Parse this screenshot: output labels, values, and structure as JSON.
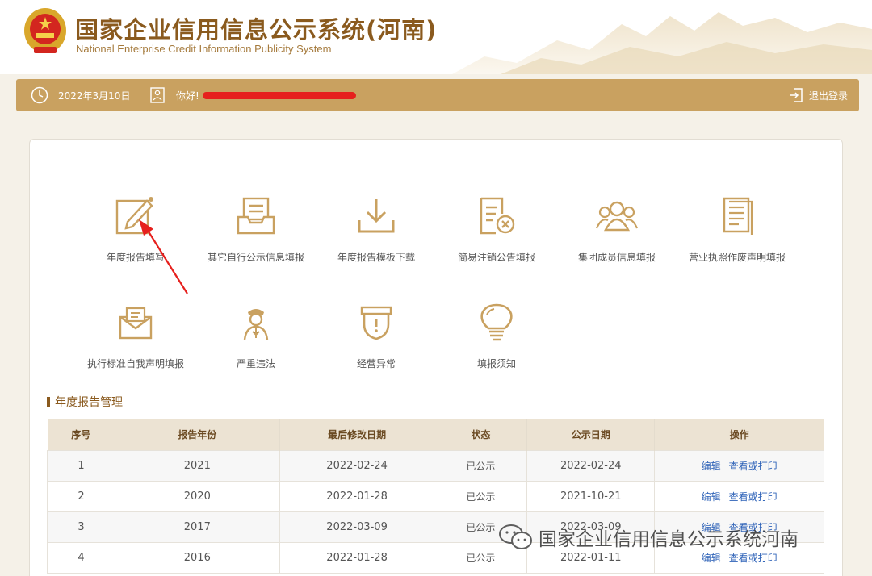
{
  "header": {
    "title": "国家企业信用信息公示系统(河南)",
    "subtitle": "National Enterprise Credit Information Publicity System"
  },
  "topbar": {
    "date": "2022年3月10日",
    "greeting": "你好!",
    "logout_label": "退出登录"
  },
  "tiles": [
    {
      "label": "年度报告填写",
      "icon": "edit-form-icon"
    },
    {
      "label": "其它自行公示信息填报",
      "icon": "inbox-document-icon"
    },
    {
      "label": "年度报告模板下载",
      "icon": "download-icon"
    },
    {
      "label": "简易注销公告填报",
      "icon": "document-cancel-icon"
    },
    {
      "label": "集团成员信息填报",
      "icon": "group-users-icon"
    },
    {
      "label": "营业执照作废声明填报",
      "icon": "documents-icon"
    },
    {
      "label": "执行标准自我声明填报",
      "icon": "envelope-icon"
    },
    {
      "label": "严重违法",
      "icon": "officer-icon"
    },
    {
      "label": "经营异常",
      "icon": "shield-alert-icon"
    },
    {
      "label": "填报须知",
      "icon": "lightbulb-icon"
    }
  ],
  "section": {
    "title": "年度报告管理"
  },
  "table": {
    "headers": [
      "序号",
      "报告年份",
      "最后修改日期",
      "状态",
      "公示日期",
      "操作"
    ],
    "rows": [
      {
        "no": "1",
        "year": "2021",
        "modified": "2022-02-24",
        "status": "已公示",
        "published": "2022-02-24",
        "edit": "编辑",
        "view": "查看或打印"
      },
      {
        "no": "2",
        "year": "2020",
        "modified": "2022-01-28",
        "status": "已公示",
        "published": "2021-10-21",
        "edit": "编辑",
        "view": "查看或打印"
      },
      {
        "no": "3",
        "year": "2017",
        "modified": "2022-03-09",
        "status": "已公示",
        "published": "2022-03-09",
        "edit": "编辑",
        "view": "查看或打印"
      },
      {
        "no": "4",
        "year": "2016",
        "modified": "2022-01-28",
        "status": "已公示",
        "published": "2022-01-11",
        "edit": "编辑",
        "view": "查看或打印"
      }
    ]
  },
  "watermark": {
    "text": "国家企业信用信息公示系统河南"
  },
  "colors": {
    "gold": "#c9a160",
    "brown": "#8a5a1e",
    "link": "#2f63b8",
    "red": "#e6201d"
  }
}
